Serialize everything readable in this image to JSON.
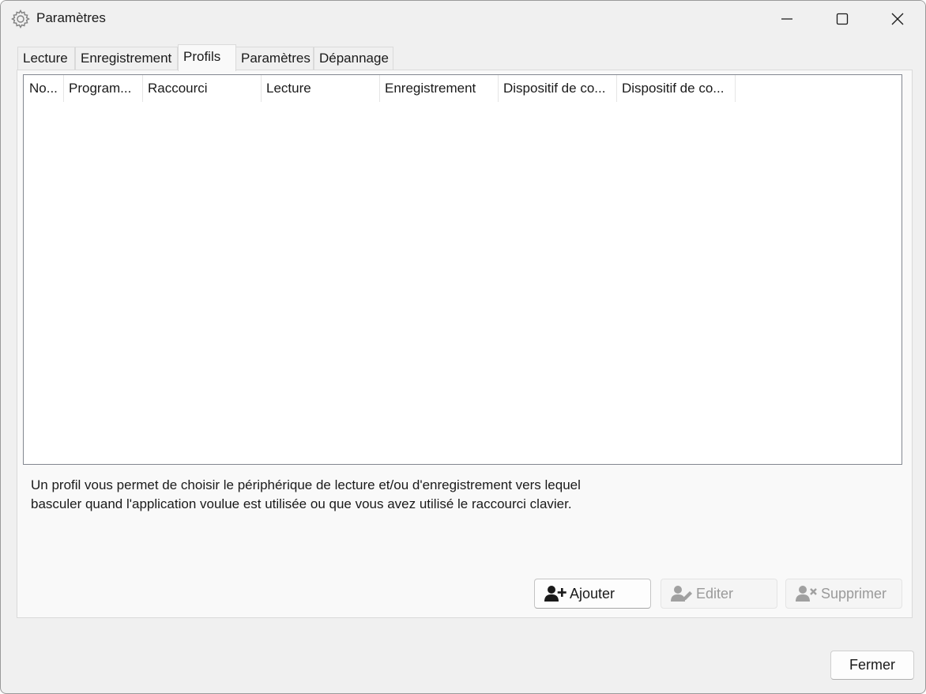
{
  "window": {
    "title": "Paramètres"
  },
  "tabs": [
    {
      "label": "Lecture"
    },
    {
      "label": "Enregistrement"
    },
    {
      "label": "Profils"
    },
    {
      "label": "Paramètres"
    },
    {
      "label": "Dépannage"
    }
  ],
  "active_tab": "Profils",
  "profiles_table": {
    "columns": [
      {
        "label": "No..."
      },
      {
        "label": "Program..."
      },
      {
        "label": "Raccourci"
      },
      {
        "label": "Lecture"
      },
      {
        "label": "Enregistrement"
      },
      {
        "label": "Dispositif de co..."
      },
      {
        "label": "Dispositif de co..."
      }
    ],
    "rows": []
  },
  "description": {
    "line1": "Un profil vous permet de choisir le périphérique de lecture et/ou d'enregistrement vers lequel",
    "line2": "basculer quand l'application voulue est utilisée ou que vous avez utilisé le raccourci clavier."
  },
  "actions": {
    "add_label": "Ajouter",
    "edit_label": "Editer",
    "delete_label": "Supprimer"
  },
  "footer": {
    "close_label": "Fermer"
  },
  "icons": {
    "app": "gear-icon",
    "add": "user-plus-icon",
    "edit": "user-edit-icon",
    "delete": "user-remove-icon"
  }
}
